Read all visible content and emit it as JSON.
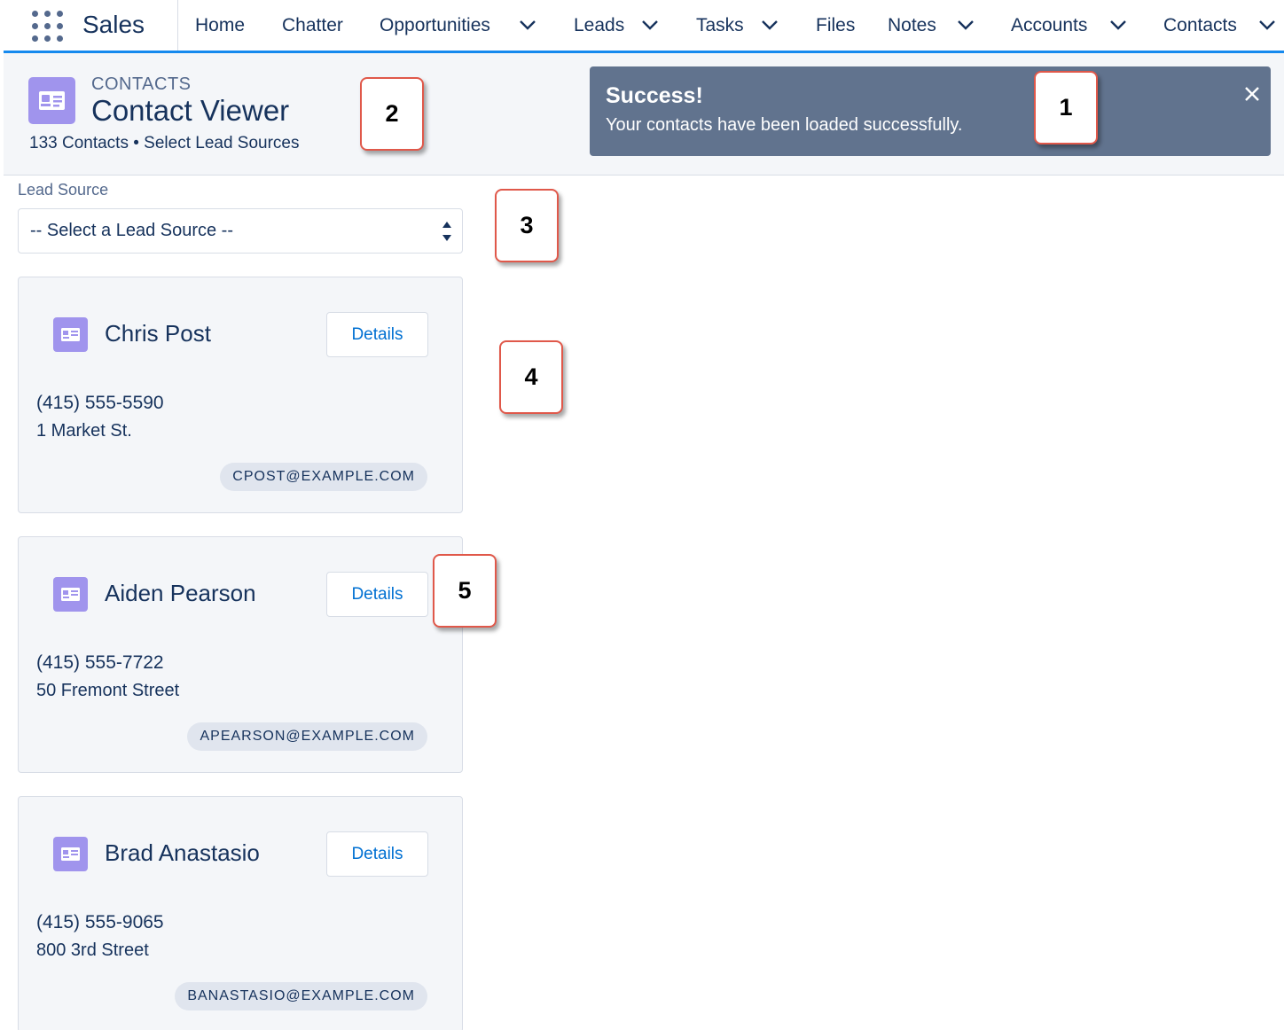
{
  "app": {
    "name": "Sales"
  },
  "nav": {
    "items": [
      {
        "label": "Home",
        "dropdown": false
      },
      {
        "label": "Chatter",
        "dropdown": false
      },
      {
        "label": "Opportunities",
        "dropdown": true
      },
      {
        "label": "Leads",
        "dropdown": true
      },
      {
        "label": "Tasks",
        "dropdown": true
      },
      {
        "label": "Files",
        "dropdown": false
      },
      {
        "label": "Notes",
        "dropdown": true
      },
      {
        "label": "Accounts",
        "dropdown": true
      },
      {
        "label": "Contacts",
        "dropdown": true
      }
    ]
  },
  "header": {
    "eyebrow": "CONTACTS",
    "title": "Contact Viewer",
    "meta": "133 Contacts • Select Lead Sources",
    "icon": "contact-card-icon"
  },
  "toast": {
    "title": "Success!",
    "message": "Your contacts have been loaded successfully.",
    "icon": "close-icon"
  },
  "filter": {
    "label": "Lead Source",
    "selected": "-- Select a Lead Source --"
  },
  "contacts": [
    {
      "name": "Chris Post",
      "button": "Details",
      "phone": "(415) 555-5590",
      "address": "1 Market St.",
      "email": "CPOST@EXAMPLE.COM"
    },
    {
      "name": "Aiden Pearson",
      "button": "Details",
      "phone": "(415) 555-7722",
      "address": "50 Fremont Street",
      "email": "APEARSON@EXAMPLE.COM"
    },
    {
      "name": "Brad Anastasio",
      "button": "Details",
      "phone": "(415) 555-9065",
      "address": "800 3rd Street",
      "email": "BANASTASIO@EXAMPLE.COM"
    }
  ],
  "callouts": [
    "1",
    "2",
    "3",
    "4",
    "5"
  ],
  "colors": {
    "accent": "#1589ee",
    "icon_bg": "#a094ed",
    "toast_bg": "#61738e",
    "link": "#0070d2",
    "callout_border": "#e0584a"
  }
}
